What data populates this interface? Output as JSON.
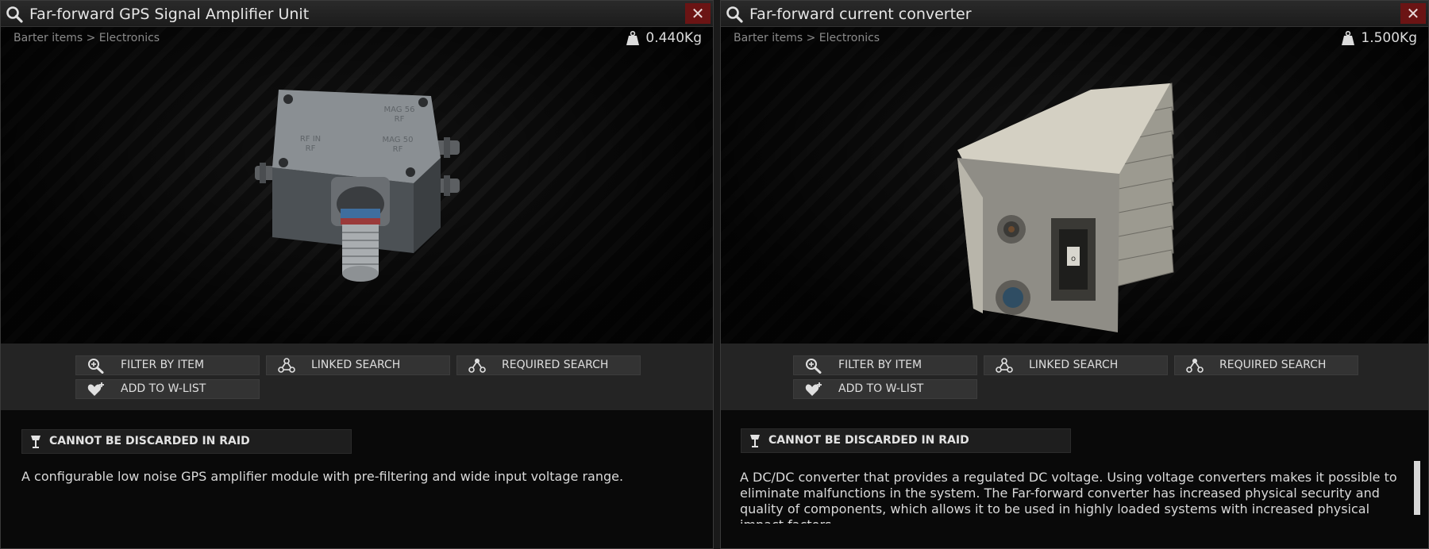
{
  "windows": [
    {
      "title": "Far-forward GPS Signal Amplifier Unit",
      "close_label": "✕",
      "breadcrumb": "Barter items > Electronics",
      "weight": "0.440Kg",
      "actions": {
        "filter": "FILTER BY ITEM",
        "linked": "LINKED SEARCH",
        "required": "REQUIRED SEARCH",
        "wishlist": "ADD TO W-LIST"
      },
      "tag": "CANNOT BE DISCARDED IN RAID",
      "description": "A configurable low noise GPS amplifier module with pre-filtering and wide input voltage range.",
      "item_markings": [
        "MAG 56",
        "RF",
        "RF IN",
        "RF",
        "MAG 50",
        "RF"
      ]
    },
    {
      "title": "Far-forward current converter",
      "close_label": "✕",
      "breadcrumb": "Barter items > Electronics",
      "weight": "1.500Kg",
      "actions": {
        "filter": "FILTER BY ITEM",
        "linked": "LINKED SEARCH",
        "required": "REQUIRED SEARCH",
        "wishlist": "ADD TO W-LIST"
      },
      "tag": "CANNOT BE DISCARDED IN RAID",
      "description": "A DC/DC converter that provides a regulated DC voltage. Using voltage converters makes it possible to eliminate malfunctions in the system. The Far-forward converter has increased physical security and quality of components, which allows it to be used in highly loaded systems with increased physical impact factors."
    }
  ],
  "colors": {
    "close_bg": "#6b1414",
    "button_bg": "#333333",
    "window_bg": "#090909"
  }
}
